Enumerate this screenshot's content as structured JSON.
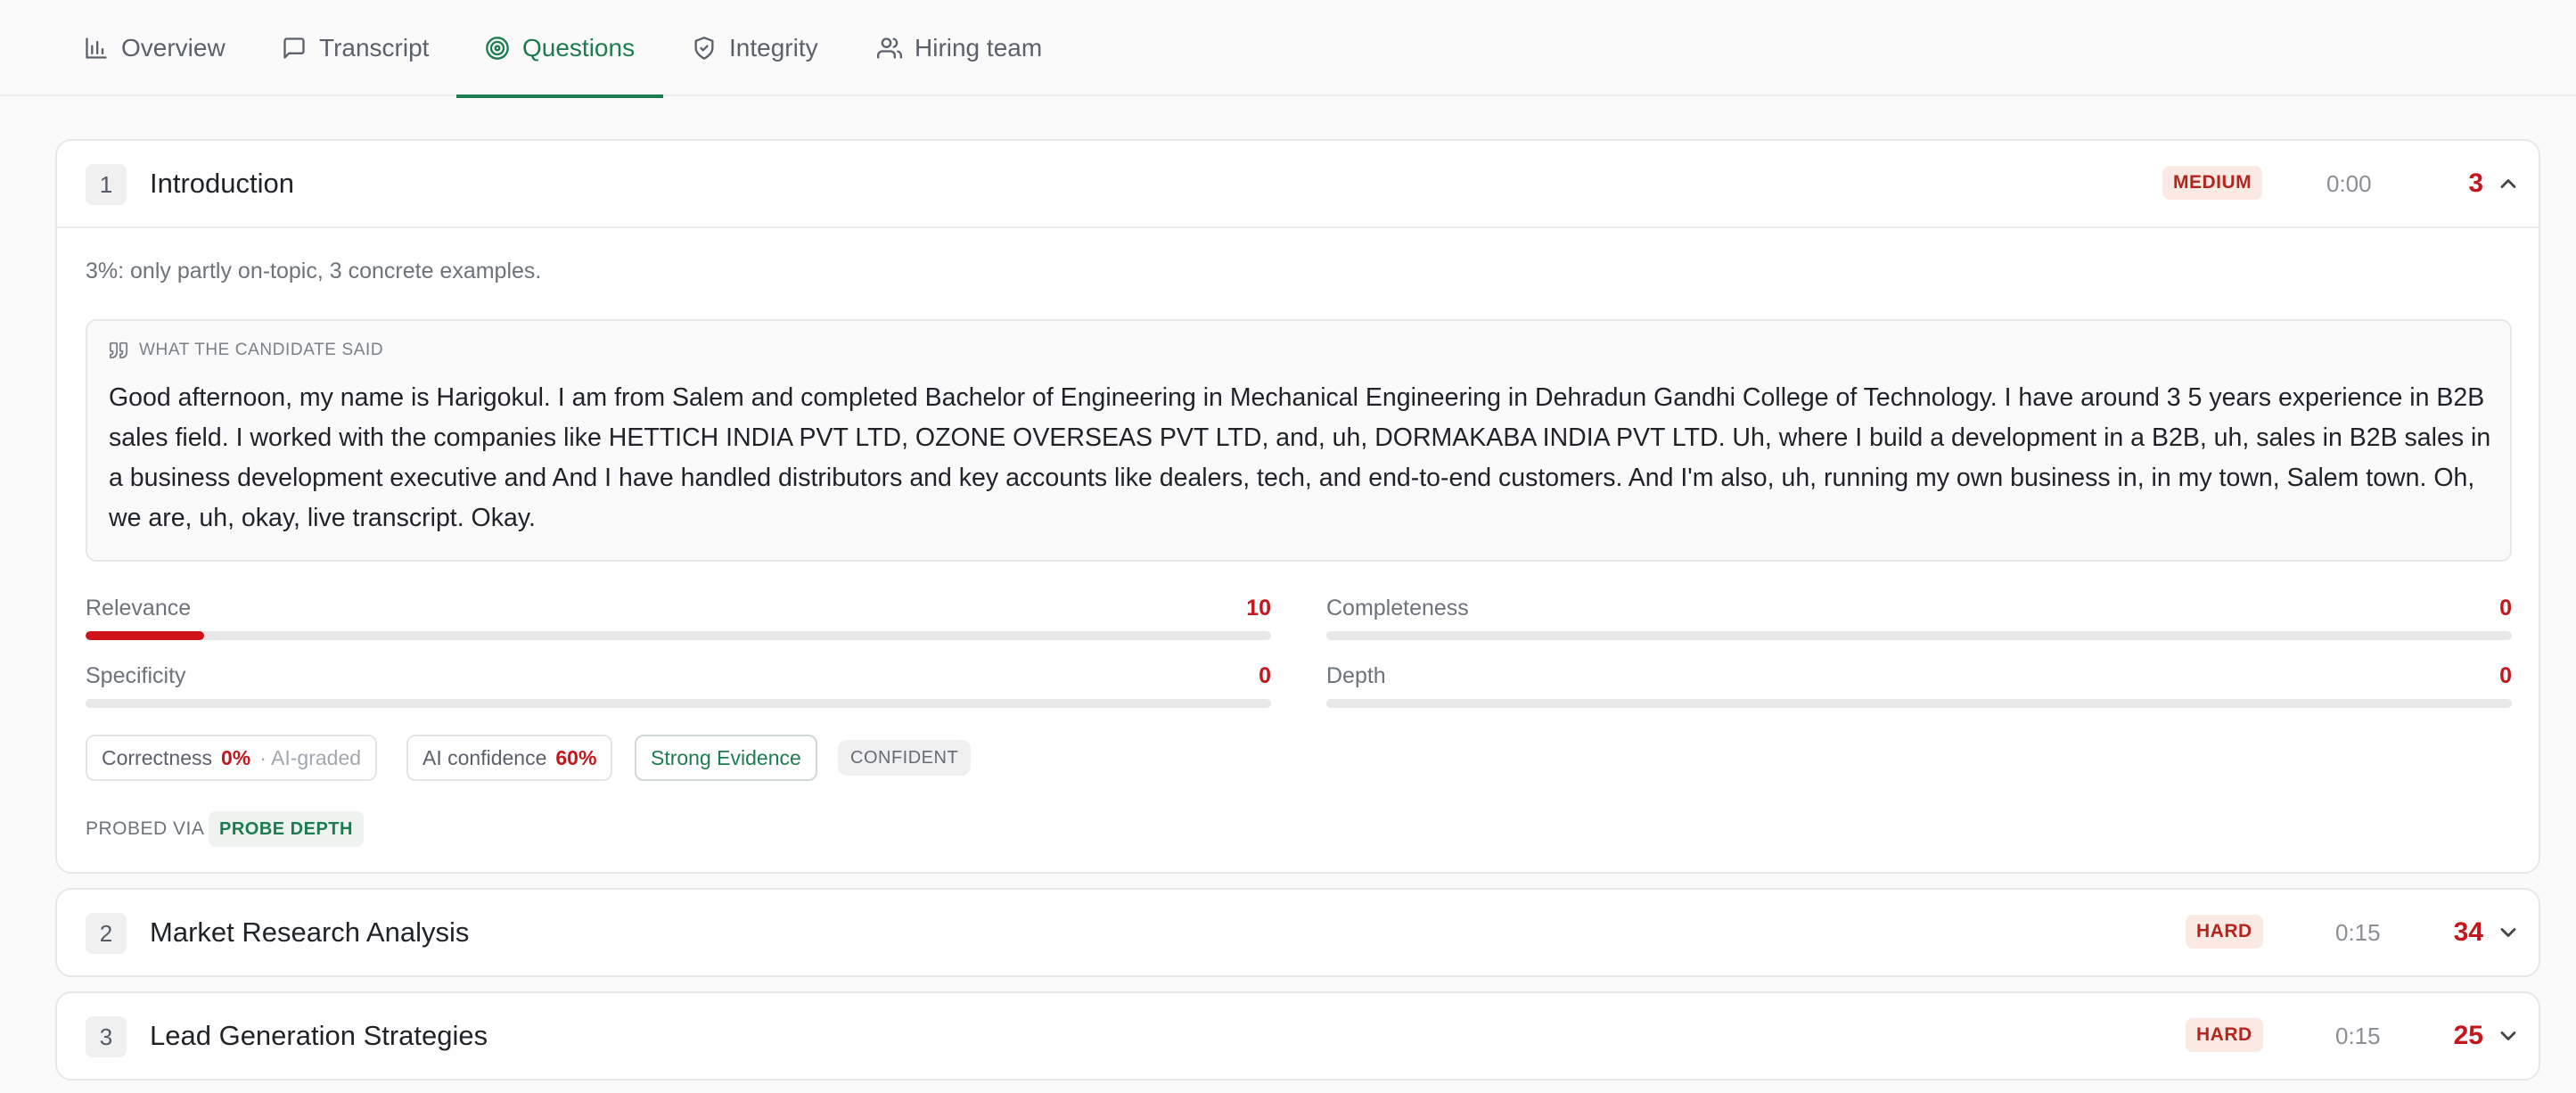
{
  "tabs": [
    {
      "label": "Overview",
      "icon": "bar-chart-icon"
    },
    {
      "label": "Transcript",
      "icon": "message-square-icon"
    },
    {
      "label": "Questions",
      "icon": "target-icon",
      "active": true
    },
    {
      "label": "Integrity",
      "icon": "shield-check-icon"
    },
    {
      "label": "Hiring team",
      "icon": "users-icon"
    }
  ],
  "colors": {
    "accent": "#1c7c4f",
    "score_red": "#c4161c",
    "hard_badge_bg": "#fbe9e4"
  },
  "questions": [
    {
      "number": "1",
      "title": "Introduction",
      "difficulty": "MEDIUM",
      "time": "0:00",
      "score": "3",
      "expanded": true,
      "summary": "3%: only partly on-topic, 3 concrete examples.",
      "said_label": "WHAT THE CANDIDATE SAID",
      "said_text": "Good afternoon, my name is Harigokul. I am from Salem and completed Bachelor of Engineering in Mechanical Engineering in Dehradun Gandhi College of Technology. I have around 3 5 years experience in B2B sales field. I worked with the companies like HETTICH INDIA PVT LTD, OZONE OVERSEAS PVT LTD, and, uh, DORMAKABA INDIA PVT LTD. Uh, where I build a development in a B2B, uh, sales in B2B sales in a business development executive and And I have handled distributors and key accounts like dealers, tech, and end-to-end customers. And I'm also, uh, running my own business in, in my town, Salem town. Oh, we are, uh, okay, live transcript. Okay.",
      "metrics": [
        {
          "label": "Relevance",
          "value": "10",
          "percent": 10
        },
        {
          "label": "Completeness",
          "value": "0",
          "percent": 0
        },
        {
          "label": "Specificity",
          "value": "0",
          "percent": 0
        },
        {
          "label": "Depth",
          "value": "0",
          "percent": 0
        }
      ],
      "correctness_label": "Correctness",
      "correctness_value": "0%",
      "correctness_note": "· AI-graded",
      "ai_confidence_label": "AI confidence",
      "ai_confidence_value": "60%",
      "evidence": "Strong Evidence",
      "confidence_tag": "CONFIDENT",
      "probed_via_label": "PROBED VIA",
      "probed_via_value": "PROBE DEPTH"
    },
    {
      "number": "2",
      "title": "Market Research Analysis",
      "difficulty": "HARD",
      "time": "0:15",
      "score": "34",
      "expanded": false
    },
    {
      "number": "3",
      "title": "Lead Generation Strategies",
      "difficulty": "HARD",
      "time": "0:15",
      "score": "25",
      "expanded": false
    }
  ]
}
